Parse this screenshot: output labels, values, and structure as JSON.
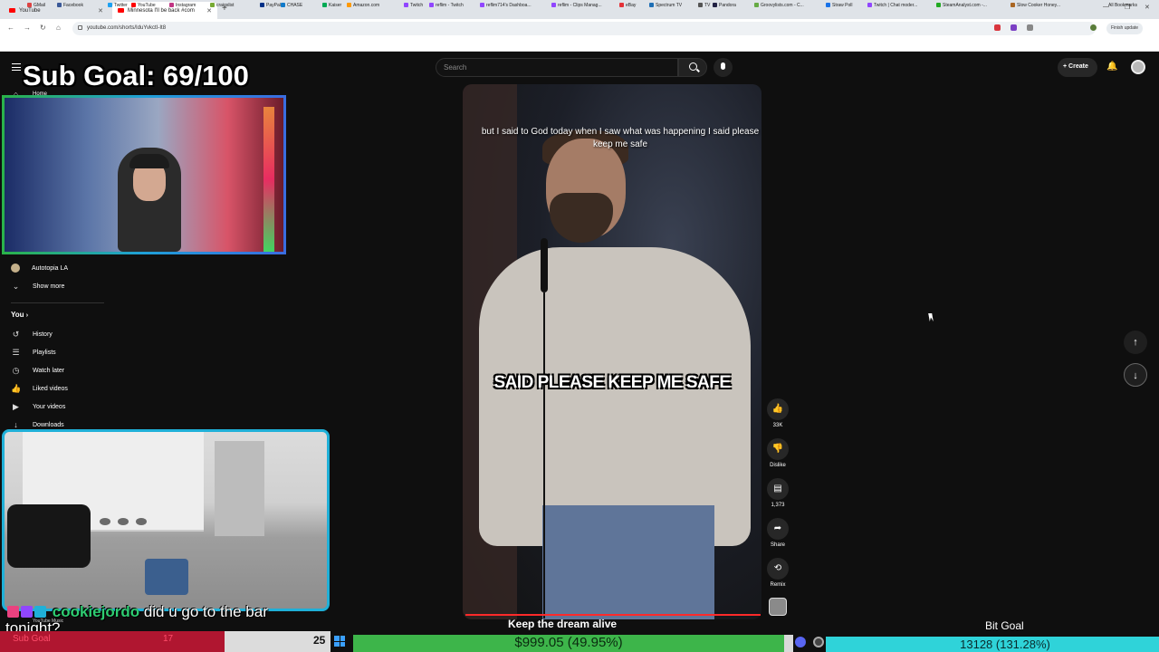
{
  "browser": {
    "tabs": [
      {
        "label": "YouTube"
      },
      {
        "label": "Minnesota I'll be back #com"
      }
    ],
    "url": "youtube.com/shorts/IduYvkctI-It8",
    "finish_update": "Finish update",
    "bookmarks": [
      "GMail",
      "Facebook",
      "Twitter",
      "YouTube",
      "Instagram",
      "craigslist",
      "PayPal",
      "CHASE",
      "Kaiser",
      "Amazon.com",
      "Twitch",
      "reflim - Twitch",
      "reflim714's Dashboa...",
      "reflim - Clips Manag...",
      "eBay",
      "Spectrum TV",
      "TV",
      "Pandora",
      "Groovylists.com - C...",
      "Straw Poll",
      "Twitch | Chat moder...",
      "SteamAnalyst.com -...",
      "Slow Cooker Honey..."
    ],
    "all_bookmarks": "All Bookmarks"
  },
  "header": {
    "search_placeholder": "Search",
    "create_label": "Create"
  },
  "sidebar": {
    "home_label": "Home",
    "subscription": "Autotopia LA",
    "show_more": "Show more",
    "you_heading": "You",
    "items": [
      {
        "label": "History",
        "icon": "history-icon"
      },
      {
        "label": "Playlists",
        "icon": "playlists-icon"
      },
      {
        "label": "Watch later",
        "icon": "watch-later-icon"
      },
      {
        "label": "Liked videos",
        "icon": "liked-icon"
      },
      {
        "label": "Your videos",
        "icon": "your-videos-icon"
      },
      {
        "label": "Downloads",
        "icon": "downloads-icon"
      }
    ]
  },
  "overlay": {
    "sub_goal_title": "Sub Goal: 69/100",
    "chat_username": "cookiejordo",
    "chat_message": "did u go to the bar",
    "chat_continuation": "tonight?",
    "youtube_music_label": "YouTube Music"
  },
  "video": {
    "caption_top": "but I said to God today when I saw what was happening I said please keep me safe",
    "caption_big": "SAID PLEASE KEEP ME SAFE",
    "title": "Keep the dream alive"
  },
  "actions": {
    "like_count": "33K",
    "dislike_label": "Dislike",
    "comment_count": "1,373",
    "share_label": "Share",
    "remix_label": "Remix"
  },
  "bottom_bars": {
    "sub_goal_label": "Sub Goal",
    "sub_goal_count": "17",
    "sub_goal_total": "25",
    "sub_goal_progress": 0.68,
    "money_text": "$999.05 (49.95%)",
    "money_progress": 0.9995,
    "bits_label": "Bit Goal",
    "bits_text": "13128 (131.28%)"
  }
}
